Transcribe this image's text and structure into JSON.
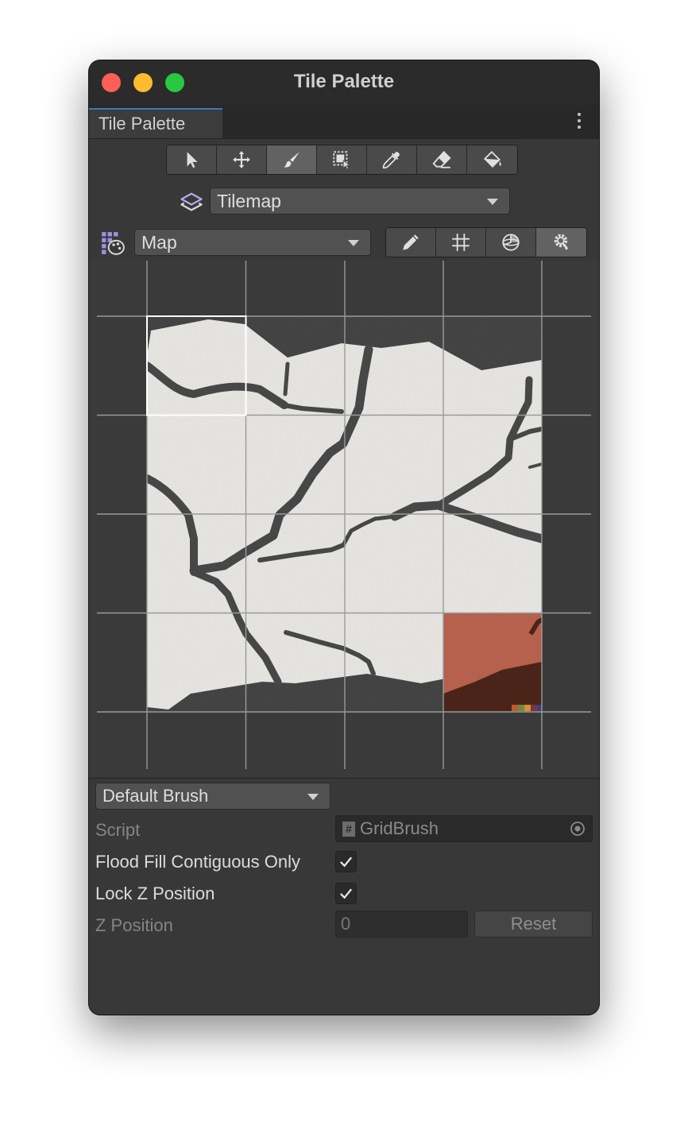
{
  "window": {
    "title": "Tile Palette"
  },
  "tab": {
    "label": "Tile Palette"
  },
  "toolbar": {
    "tools": [
      {
        "name": "select-tool",
        "icon": "arrow-cursor-icon",
        "active": false
      },
      {
        "name": "move-tool",
        "icon": "move-arrows-icon",
        "active": false
      },
      {
        "name": "paint-tool",
        "icon": "brush-icon",
        "active": true
      },
      {
        "name": "box-fill-tool",
        "icon": "box-select-icon",
        "active": false
      },
      {
        "name": "picker-tool",
        "icon": "eyedropper-icon",
        "active": false
      },
      {
        "name": "erase-tool",
        "icon": "eraser-icon",
        "active": false
      },
      {
        "name": "fill-tool",
        "icon": "paint-bucket-icon",
        "active": false
      }
    ]
  },
  "target": {
    "icon": "layers-icon",
    "value": "Tilemap"
  },
  "palette": {
    "icon": "palette-grid-icon",
    "value": "Map"
  },
  "edit_tools": [
    {
      "name": "edit-palette-button",
      "icon": "pencil-icon"
    },
    {
      "name": "grid-toggle-button",
      "icon": "grid-icon"
    },
    {
      "name": "gizmos-toggle-button",
      "icon": "gizmo-icon"
    },
    {
      "name": "settings-button",
      "icon": "gear-icon"
    }
  ],
  "brush": {
    "dropdown": "Default Brush",
    "script_label": "Script",
    "script_value": "GridBrush",
    "script_icon": "#",
    "flood_label": "Flood Fill Contiguous Only",
    "flood_checked": true,
    "lockz_label": "Lock Z Position",
    "lockz_checked": true,
    "zpos_label": "Z Position",
    "zpos_value": "0",
    "reset_label": "Reset"
  },
  "colors": {
    "accent": "#3a79bb",
    "tile_light": "#e7e5e2",
    "tile_crack": "#3b3b3b",
    "tile_orange": "#b6614d"
  }
}
